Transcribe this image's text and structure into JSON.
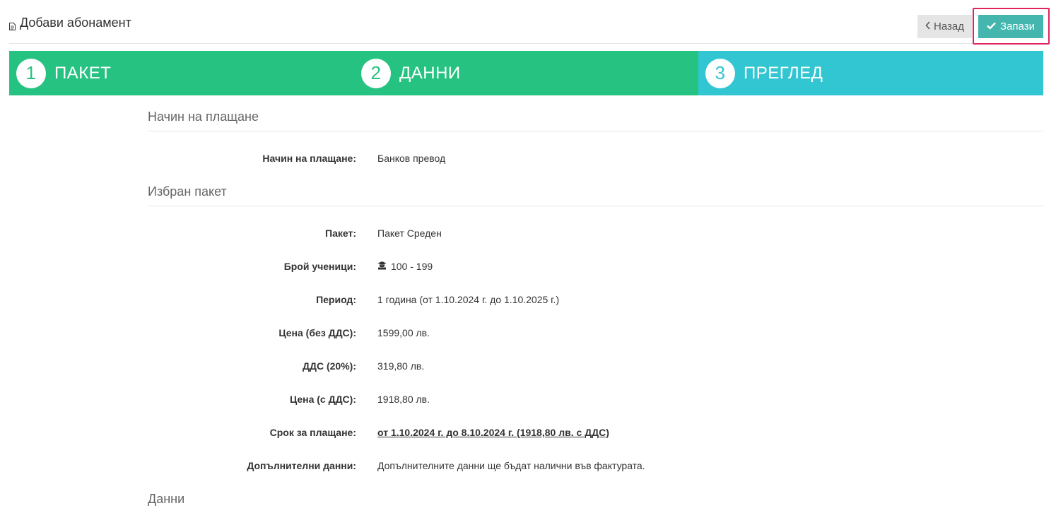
{
  "header": {
    "title": "Добави абонамент",
    "title_icon": "file-icon",
    "back_label": "Назад",
    "save_label": "Запази"
  },
  "steps": [
    {
      "num": "1",
      "label": "ПАКЕТ",
      "color": "#26c281"
    },
    {
      "num": "2",
      "label": "ДАННИ",
      "color": "#26c281"
    },
    {
      "num": "3",
      "label": "ПРЕГЛЕД",
      "color": "#32c5d2"
    }
  ],
  "sections": {
    "payment_title": "Начин на плащане",
    "package_title": "Избран пакет",
    "data_title": "Данни"
  },
  "payment": {
    "method_label": "Начин на плащане:",
    "method_value": "Банков превод"
  },
  "package": {
    "name_label": "Пакет:",
    "name_value": "Пакет Среден",
    "students_label": "Брой ученици:",
    "students_value": "100 - 199",
    "students_icon": "graduation-cap-icon",
    "period_label": "Период:",
    "period_value": "1 година (от 1.10.2024 г. до 1.10.2025 г.)",
    "price_label": "Цена (без ДДС):",
    "price_value": "1599,00 лв.",
    "vat_label": "ДДС (20%):",
    "vat_value": "319,80 лв.",
    "total_label": "Цена (с ДДС):",
    "total_value": "1918,80 лв.",
    "deadline_label": "Срок за плащане:",
    "deadline_value": "от 1.10.2024 г. до 8.10.2024 г. (1918,80 лв. с ДДС)",
    "extra_label": "Допълнителни данни:",
    "extra_value": "Допълнителните данни ще бъдат налични във фактурата."
  },
  "colors": {
    "step_active": "#26c281",
    "step_current": "#32c5d2",
    "save_button": "#44b6ae",
    "highlight": "#e0245e"
  }
}
